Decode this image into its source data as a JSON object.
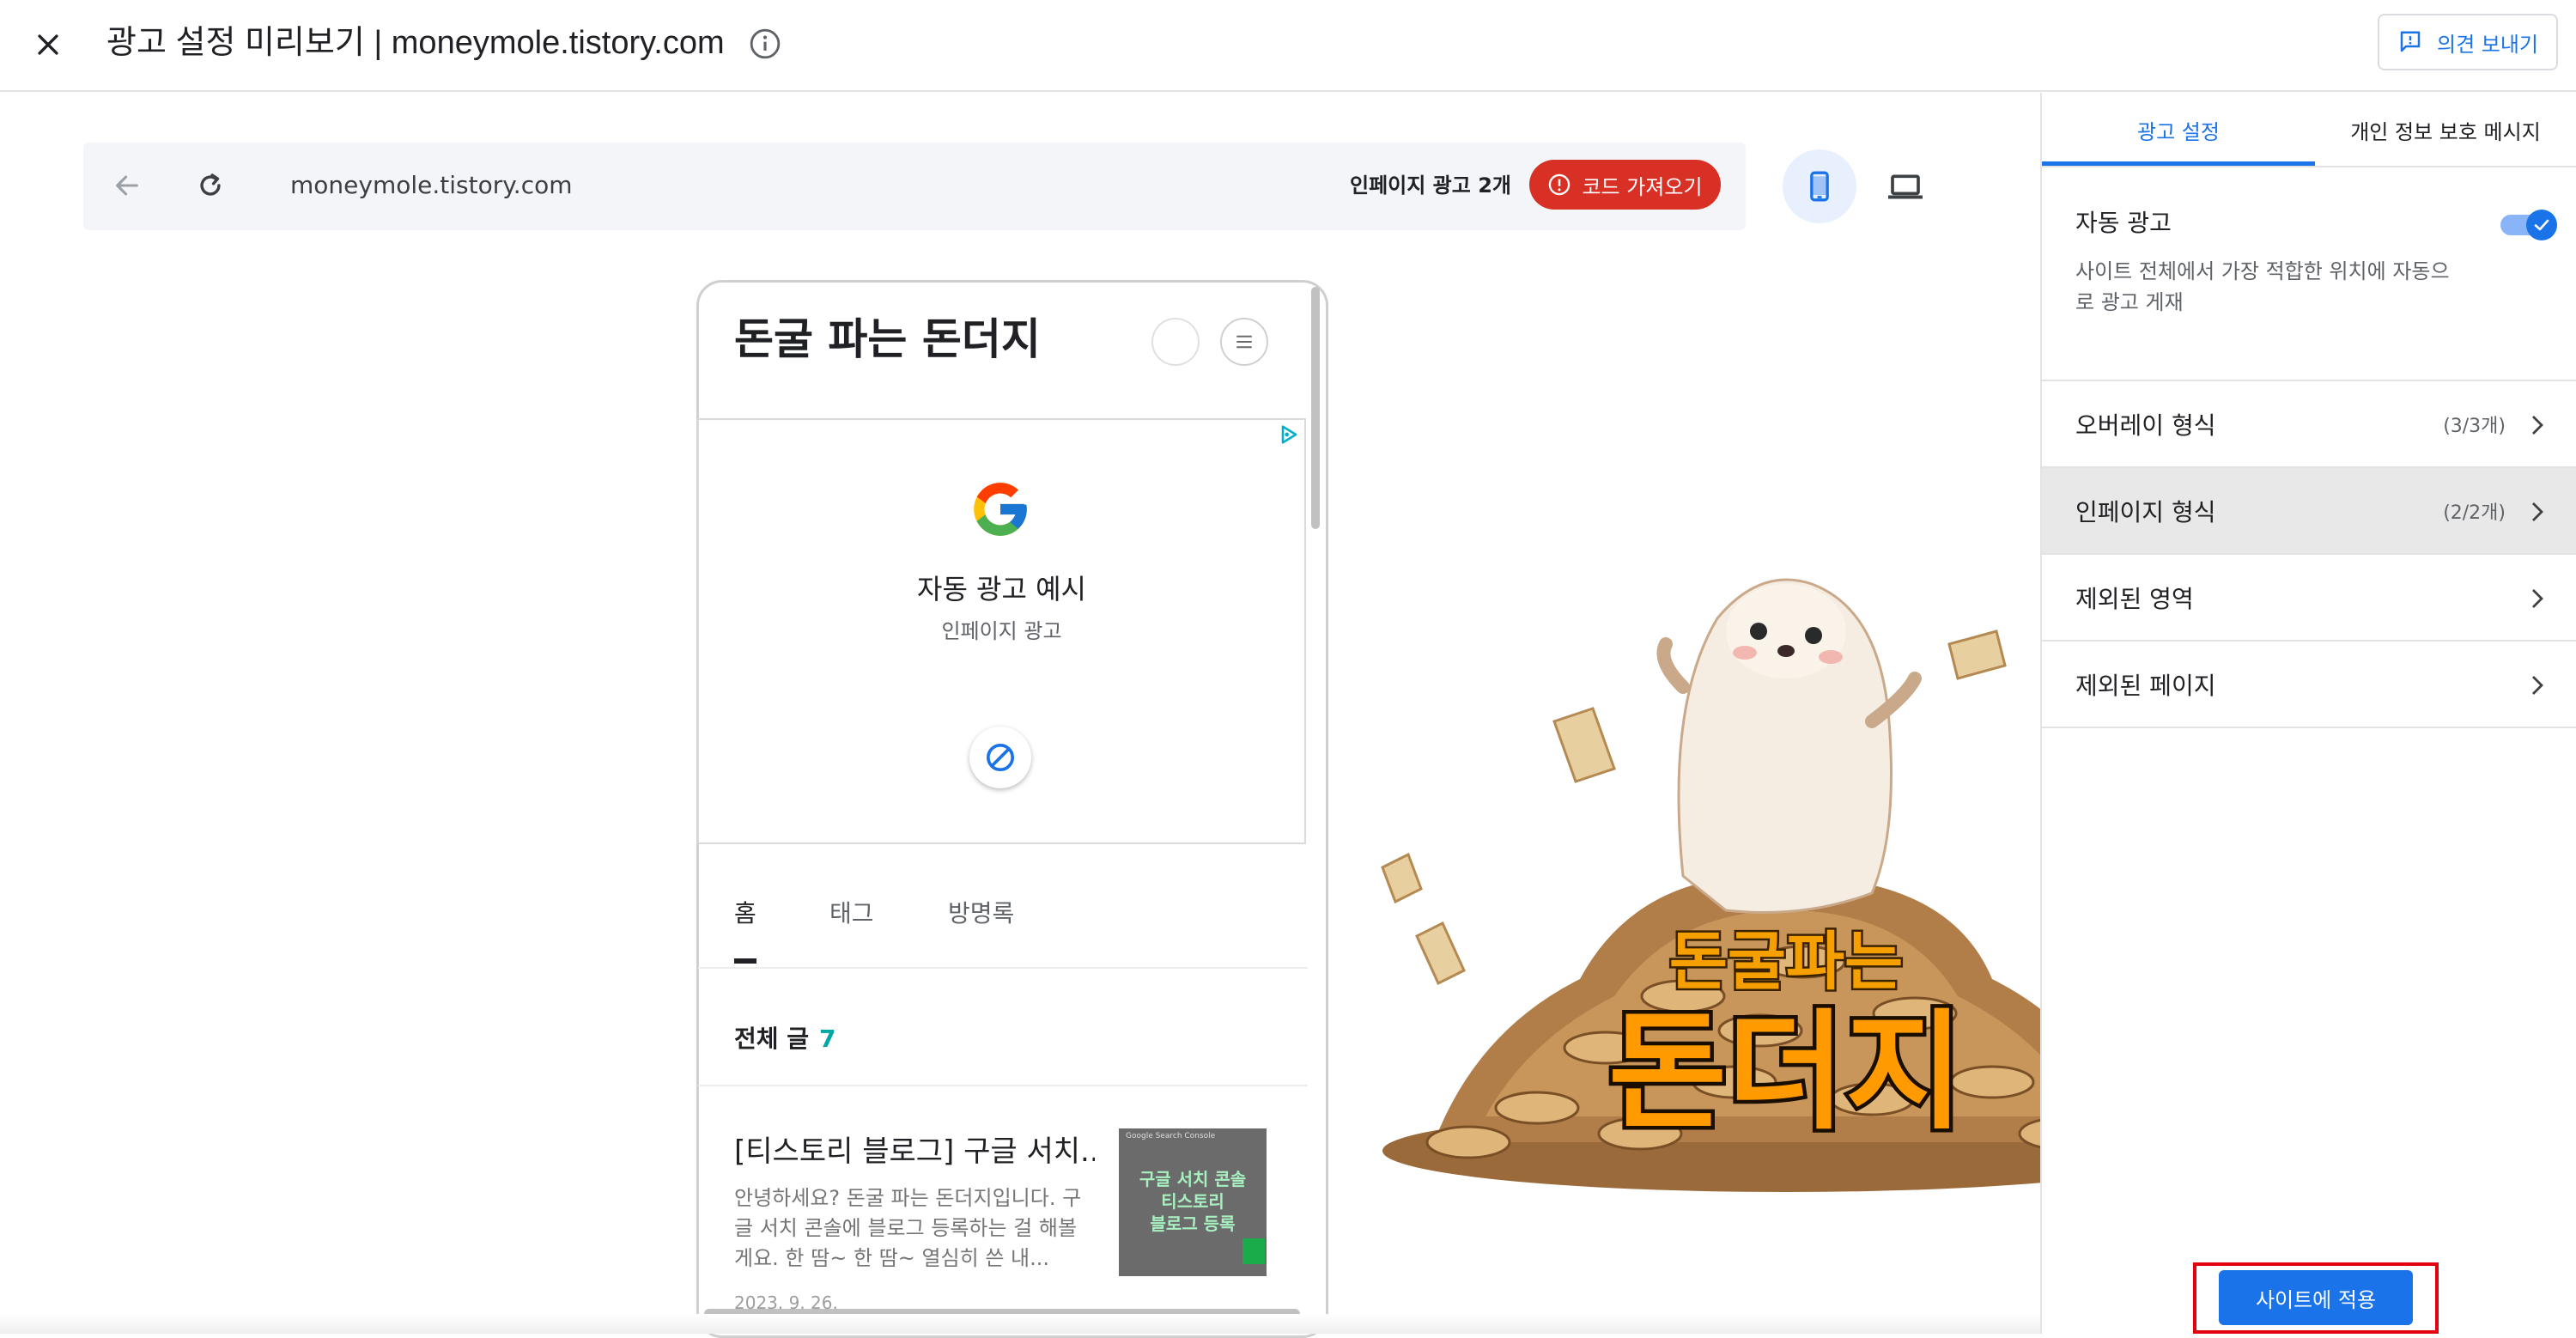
{
  "header": {
    "title": "광고 설정 미리보기 | moneymole.tistory.com",
    "feedback_label": "의견 보내기"
  },
  "preview_toolbar": {
    "url": "moneymole.tistory.com",
    "inpage_ad_count": "인페이지 광고 2개",
    "get_code_label": "코드 가져오기",
    "selected_device": "mobile"
  },
  "blog": {
    "title": "돈굴 파는 돈더지",
    "ad": {
      "title": "자동 광고 예시",
      "subtitle": "인페이지 광고"
    },
    "tabs": [
      {
        "label": "홈",
        "active": true
      },
      {
        "label": "태그",
        "active": false
      },
      {
        "label": "방명록",
        "active": false
      }
    ],
    "all_posts_label": "전체 글",
    "all_posts_count": "7",
    "post": {
      "title": "[티스토리 블로그] 구글 서치...",
      "excerpt": "안녕하세요? 돈굴 파는 돈더지입니다. 구글 서치 콘솔에 블로그 등록하는 걸 해볼게요. 한 땀~ 한 땀~ 열심히 쓴 내...",
      "date": "2023. 9. 26.",
      "thumb_text": "구글 서치 콘솔\n티스토리\n블로그 등록",
      "thumb_header": "Google Search Console"
    },
    "banner_line1": "돈굴파는",
    "banner_line2": "돈더지"
  },
  "right_panel": {
    "tabs": [
      {
        "label": "광고 설정",
        "active": true
      },
      {
        "label": "개인 정보 보호 메시지",
        "active": false
      }
    ],
    "auto_ads": {
      "label": "자동 광고",
      "description": "사이트 전체에서 가장 적합한 위치에 자동으로 광고 게재",
      "enabled": true
    },
    "rows": [
      {
        "label": "오버레이 형식",
        "count": "(3/3개)",
        "selected": false
      },
      {
        "label": "인페이지 형식",
        "count": "(2/2개)",
        "selected": true
      },
      {
        "label": "제외된 영역",
        "count": "",
        "selected": false
      },
      {
        "label": "제외된 페이지",
        "count": "",
        "selected": false
      }
    ],
    "apply_label": "사이트에 적용"
  },
  "colors": {
    "accent": "#1a73e8",
    "danger": "#d93025",
    "highlight_border": "#e3000f",
    "post_count": "#00a7a7"
  },
  "icons": {
    "close": "close-icon",
    "info": "info-icon",
    "feedback": "feedback-icon",
    "back": "arrow-back-icon",
    "reload": "reload-icon",
    "alert": "alert-circle-icon",
    "mobile": "smartphone-icon",
    "desktop": "laptop-icon",
    "adchoices": "adchoices-icon",
    "block": "block-icon",
    "chevron": "chevron-right-icon",
    "menu": "hamburger-menu-icon"
  }
}
